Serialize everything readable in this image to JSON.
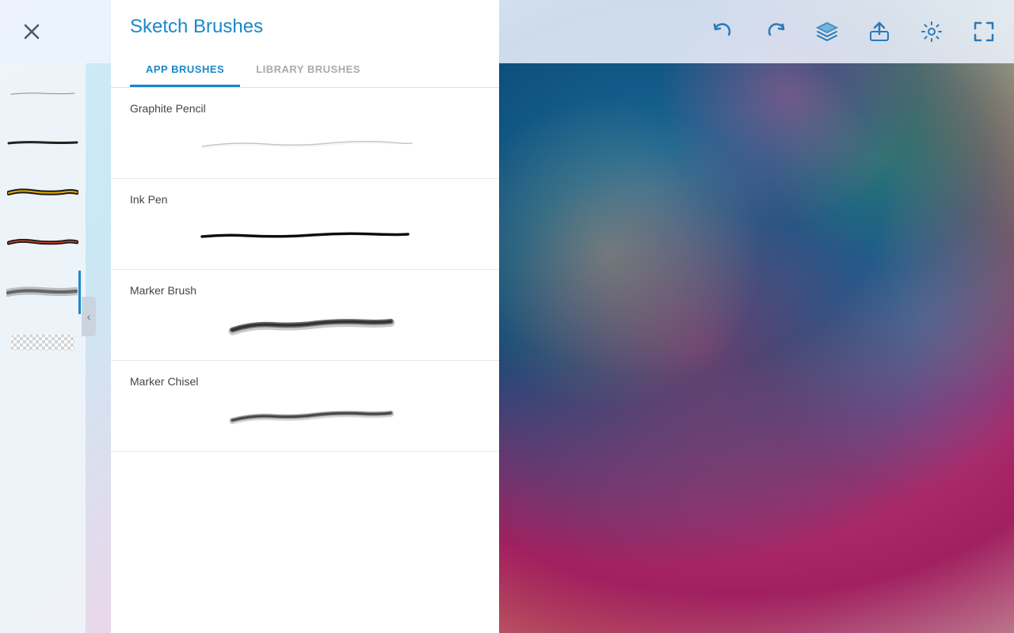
{
  "app": {
    "title": "Sketch Brushes"
  },
  "toolbar": {
    "undo_label": "Undo",
    "redo_label": "Redo",
    "layers_label": "Layers",
    "export_label": "Export",
    "settings_label": "Settings",
    "fullscreen_label": "Fullscreen"
  },
  "panel": {
    "title": "Sketch Brushes",
    "tabs": [
      {
        "id": "app-brushes",
        "label": "APP BRUSHES",
        "active": true
      },
      {
        "id": "library-brushes",
        "label": "LIBRARY BRUSHES",
        "active": false
      }
    ],
    "brushes": [
      {
        "id": "graphite-pencil",
        "name": "Graphite Pencil",
        "stroke_type": "graphite"
      },
      {
        "id": "ink-pen",
        "name": "Ink Pen",
        "stroke_type": "ink"
      },
      {
        "id": "marker-brush",
        "name": "Marker Brush",
        "stroke_type": "marker"
      },
      {
        "id": "marker-chisel",
        "name": "Marker Chisel",
        "stroke_type": "chisel"
      }
    ]
  },
  "sidebar": {
    "items": [
      {
        "id": "brush-1",
        "type": "fine-line",
        "active": false
      },
      {
        "id": "brush-2",
        "type": "medium-line",
        "active": false
      },
      {
        "id": "brush-3",
        "type": "thick-dark",
        "active": false
      },
      {
        "id": "brush-4",
        "type": "tapered",
        "active": false
      },
      {
        "id": "brush-5",
        "type": "soft-gray",
        "active": true
      },
      {
        "id": "brush-6",
        "type": "texture",
        "active": false
      }
    ]
  },
  "close": {
    "label": "×"
  },
  "collapse": {
    "label": "‹"
  },
  "colors": {
    "accent": "#1a88c9",
    "text_dark": "#333333",
    "text_muted": "#aaaaaa",
    "border": "#e0e0e0",
    "panel_bg": "#ffffff",
    "toolbar_bg": "#f0f5ff"
  }
}
